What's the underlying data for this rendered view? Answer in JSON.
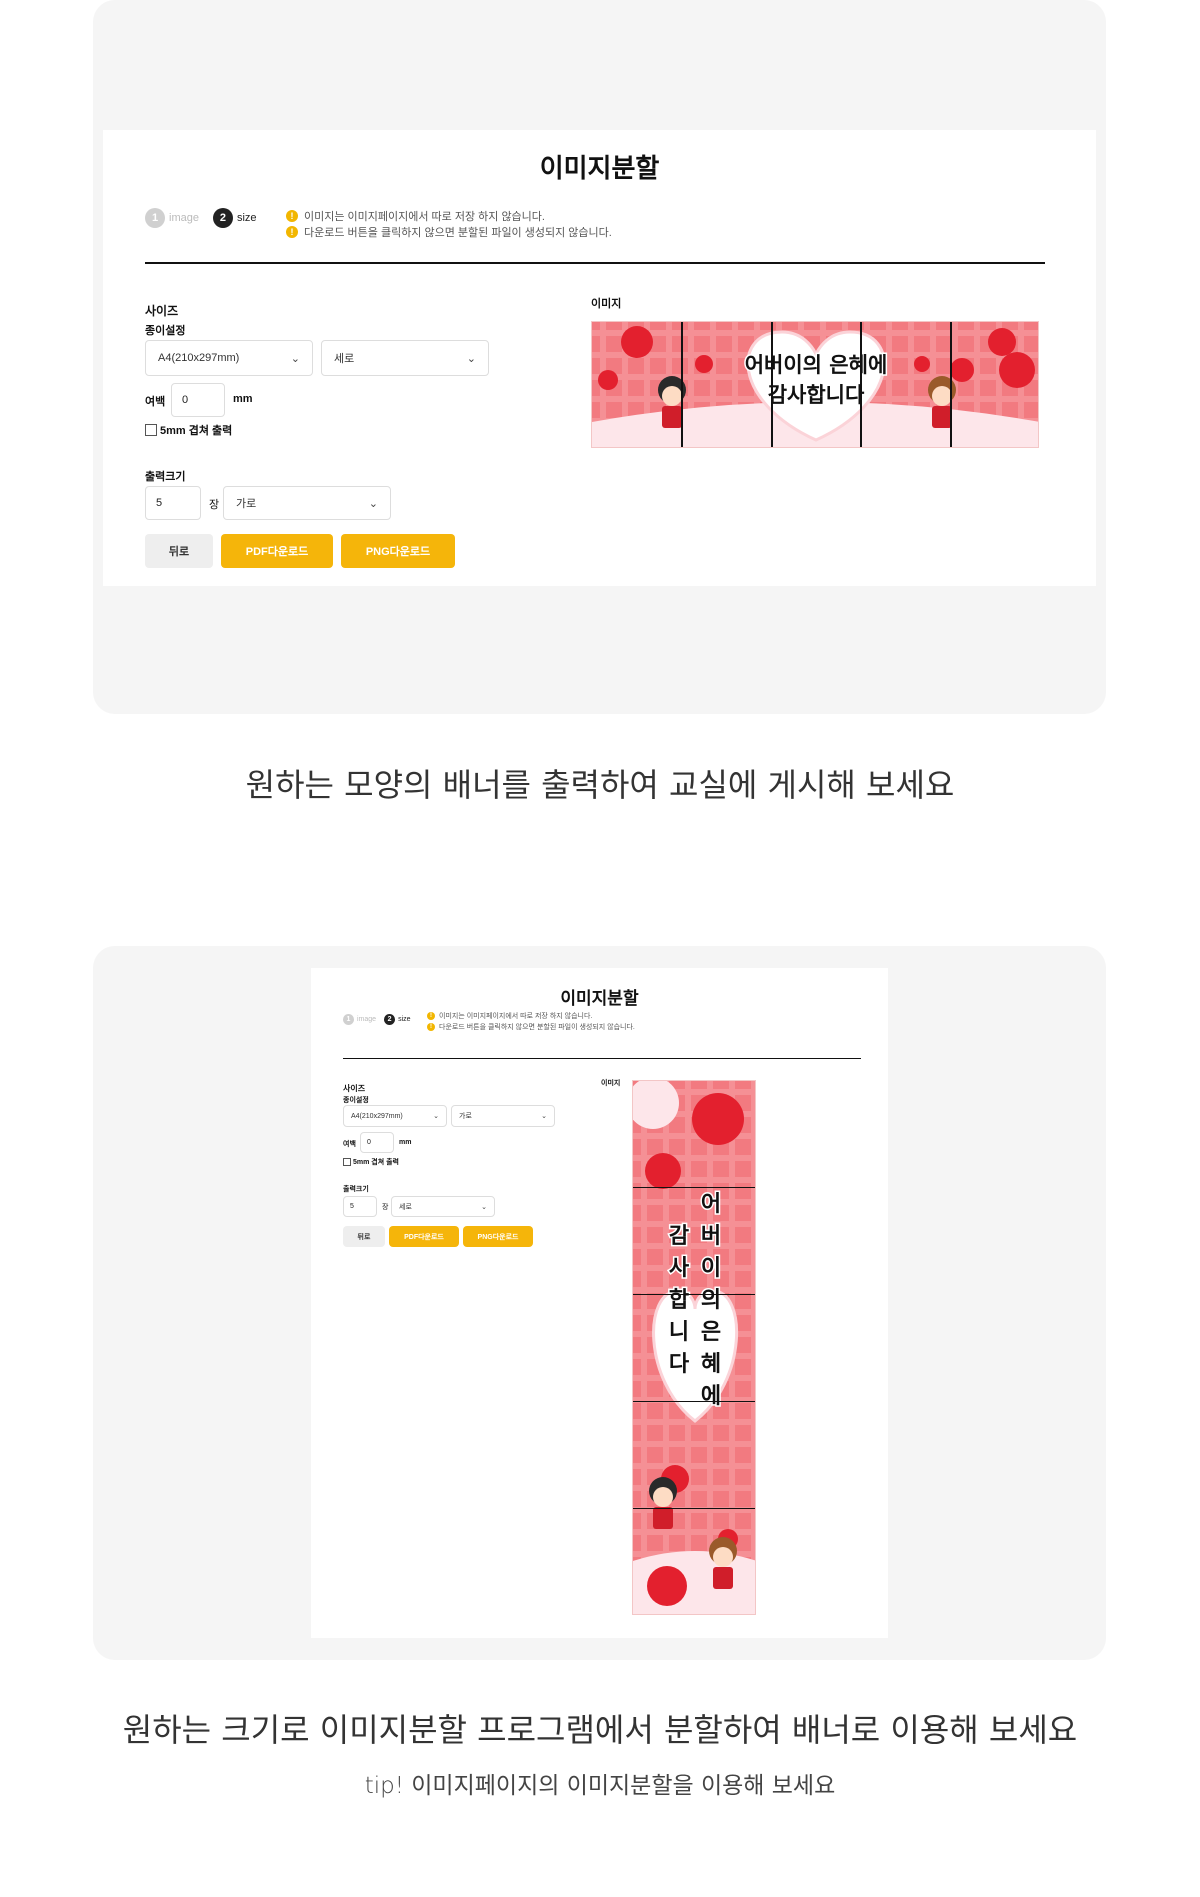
{
  "tool": {
    "title": "이미지분할",
    "steps": [
      {
        "num": "1",
        "label": "image"
      },
      {
        "num": "2",
        "label": "size"
      }
    ],
    "notices": [
      "이미지는 이미지페이지에서 따로 저장 하지 않습니다.",
      "다운로드 버튼을 클릭하지 않으면 분할된 파일이 생성되지 않습니다."
    ],
    "warn_icon": "!",
    "size_label": "사이즈",
    "paper_label": "종이설정",
    "paper_value": "A4(210x297mm)",
    "margin_label": "여백",
    "margin_value": "0",
    "margin_unit": "mm",
    "overlap_label": "5mm 겹쳐 출력",
    "output_label": "출력크기",
    "count_value": "5",
    "count_unit": "장",
    "back_button": "뒤로",
    "pdf_button": "PDF다운로드",
    "png_button": "PNG다운로드",
    "image_label": "이미지"
  },
  "screens": [
    {
      "orientation_value": "세로",
      "direction_value": "가로"
    },
    {
      "orientation_value": "가로",
      "direction_value": "세로"
    }
  ],
  "banner": {
    "line1": "어버이의 은혜에",
    "line2": "감사합니다",
    "vertical_col1": [
      "어",
      "버",
      "이",
      "의",
      "은",
      "혜",
      "에"
    ],
    "vertical_col2": [
      "감",
      "사",
      "합",
      "니",
      "다"
    ]
  },
  "captions": {
    "caption1": "원하는 모양의 배너를 출력하여 교실에 게시해 보세요",
    "caption2": "원하는 크기로 이미지분할 프로그램에서 분할하여 배너로 이용해 보세요",
    "tip": "tip! 이미지페이지의 이미지분할을 이용해 보세요"
  },
  "colors": {
    "panel_bg": "#f5f5f5",
    "accent_yellow": "#f5b50a",
    "banner_pink": "#f27a80",
    "heart_pink": "#fde6ea",
    "flower_red": "#e3202e"
  },
  "icons": {
    "chevron": "chevron-down-icon",
    "warning": "warning-icon",
    "checkbox": "checkbox-icon"
  }
}
